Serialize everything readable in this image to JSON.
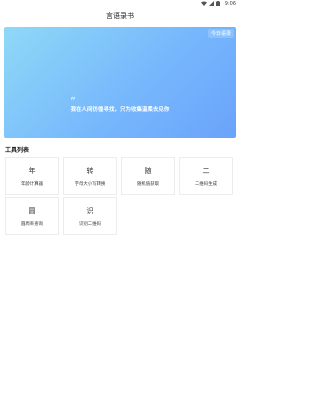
{
  "status_bar": {
    "time": "9:06",
    "icons": [
      "wifi-icon",
      "signal-icon",
      "battery-icon"
    ]
  },
  "header": {
    "title": "言语录书"
  },
  "banner": {
    "tag": "今日语录",
    "quote_mark": "“",
    "quote": "我在人间彷徨寻找，只为收集温柔去见你",
    "gradient_colors": [
      "#8fd9f7",
      "#77b8fc",
      "#6aa3fb"
    ]
  },
  "tools": {
    "section_title": "工具列表",
    "items": [
      {
        "icon_char": "年",
        "label": "年龄计算器"
      },
      {
        "icon_char": "转",
        "label": "字母大小写转换"
      },
      {
        "icon_char": "随",
        "label": "随机值获取"
      },
      {
        "icon_char": "二",
        "label": "二维码生成"
      },
      {
        "icon_char": "圆",
        "label": "圆周率查询"
      },
      {
        "icon_char": "识",
        "label": "识别二维码"
      }
    ]
  }
}
